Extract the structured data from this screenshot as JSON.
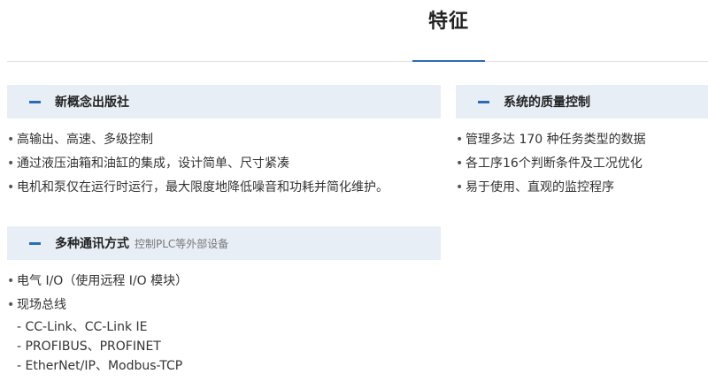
{
  "page": {
    "title": "特征"
  },
  "sections": {
    "concept": {
      "title": "新概念出版社",
      "items": [
        "高输出、高速、多级控制",
        "通过液压油箱和油缸的集成，设计简单、尺寸紧凑",
        "电机和泵仅在运行时运行，最大限度地降低噪音和功耗并简化维护。"
      ]
    },
    "quality": {
      "title": "系统的质量控制",
      "items": [
        "管理多达 170 种任务类型的数据",
        "各工序16个判断条件及工况优化",
        "易于使用、直观的监控程序"
      ]
    },
    "comm": {
      "title": "多种通讯方式",
      "subtitle": "控制PLC等外部设备",
      "items": [
        "电气 I/O（使用远程 I/O 模块）",
        "现场总线"
      ],
      "fieldbus": [
        "- CC-Link、CC-Link IE",
        "- PROFIBUS、PROFINET",
        "- EtherNet/IP、Modbus-TCP"
      ]
    }
  },
  "colors": {
    "accent": "#2b6db3",
    "header_bg": "#e8eef6",
    "rule": "#e1e1e1"
  },
  "bullet_glyph": "•"
}
